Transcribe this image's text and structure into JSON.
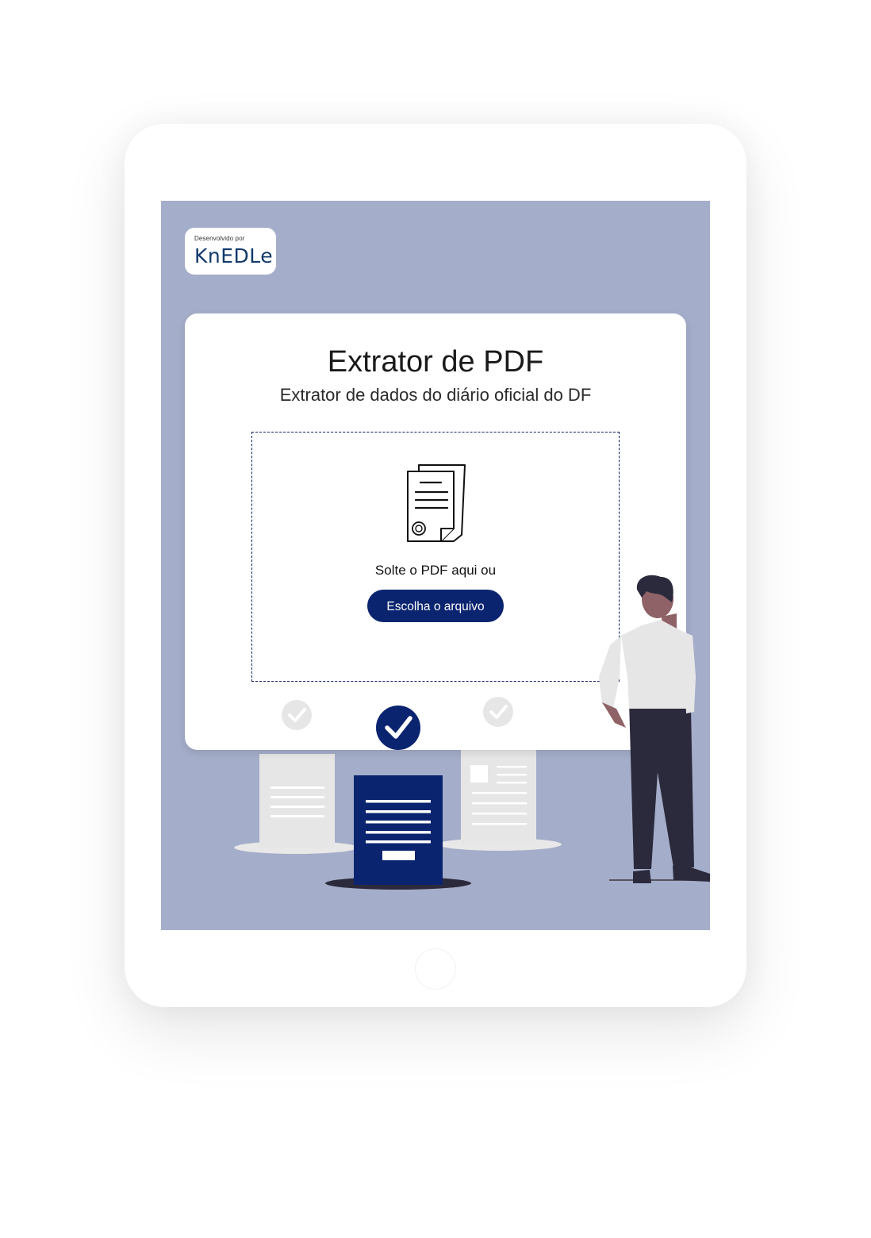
{
  "badge": {
    "small_text": "Desenvolvido por",
    "logo_text": "KnEDLe"
  },
  "card": {
    "title": "Extrator de PDF",
    "subtitle": "Extrator de dados do diário oficial do DF"
  },
  "dropzone": {
    "prompt": "Solte o PDF aqui ou",
    "button_label": "Escolha o arquivo"
  },
  "colors": {
    "screen_bg": "#a4adc9",
    "accent": "#0b2470",
    "logo": "#123a6b"
  },
  "icons": [
    "document-seal-icon",
    "check-circle-icon",
    "person-illustration",
    "document-icon"
  ]
}
